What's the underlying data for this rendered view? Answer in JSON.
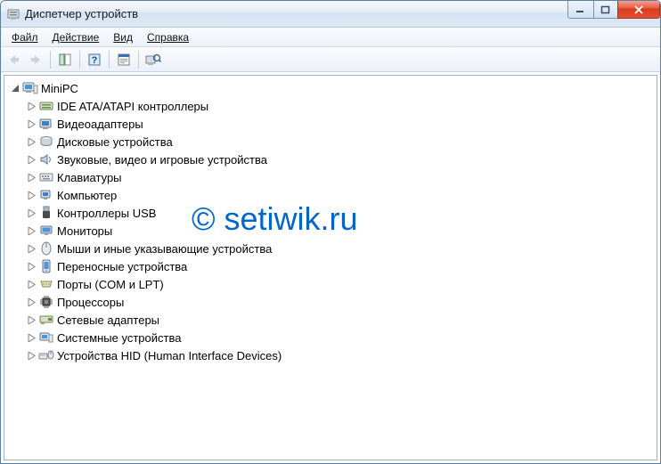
{
  "window": {
    "title": "Диспетчер устройств"
  },
  "menu": {
    "file": "Файл",
    "action": "Действие",
    "view": "Вид",
    "help": "Справка"
  },
  "tree": {
    "root": "MiniPC",
    "items": [
      "IDE ATA/ATAPI контроллеры",
      "Видеоадаптеры",
      "Дисковые устройства",
      "Звуковые, видео и игровые устройства",
      "Клавиатуры",
      "Компьютер",
      "Контроллеры USB",
      "Мониторы",
      "Мыши и иные указывающие устройства",
      "Переносные устройства",
      "Порты (COM и LPT)",
      "Процессоры",
      "Сетевые адаптеры",
      "Системные устройства",
      "Устройства HID (Human Interface Devices)"
    ]
  },
  "watermark": "© setiwik.ru"
}
